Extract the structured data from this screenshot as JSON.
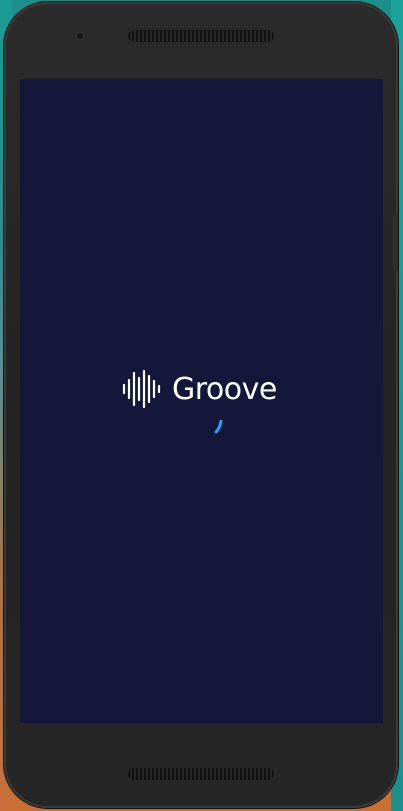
{
  "app": {
    "name": "Groove",
    "logo_icon": "soundwave-icon",
    "loading_indicator": "loading-spinner-icon"
  },
  "colors": {
    "screen_background": "#141739",
    "logo_text": "#ffffff",
    "spinner_accent": "#1ea7f0",
    "device_frame": "#262626"
  }
}
